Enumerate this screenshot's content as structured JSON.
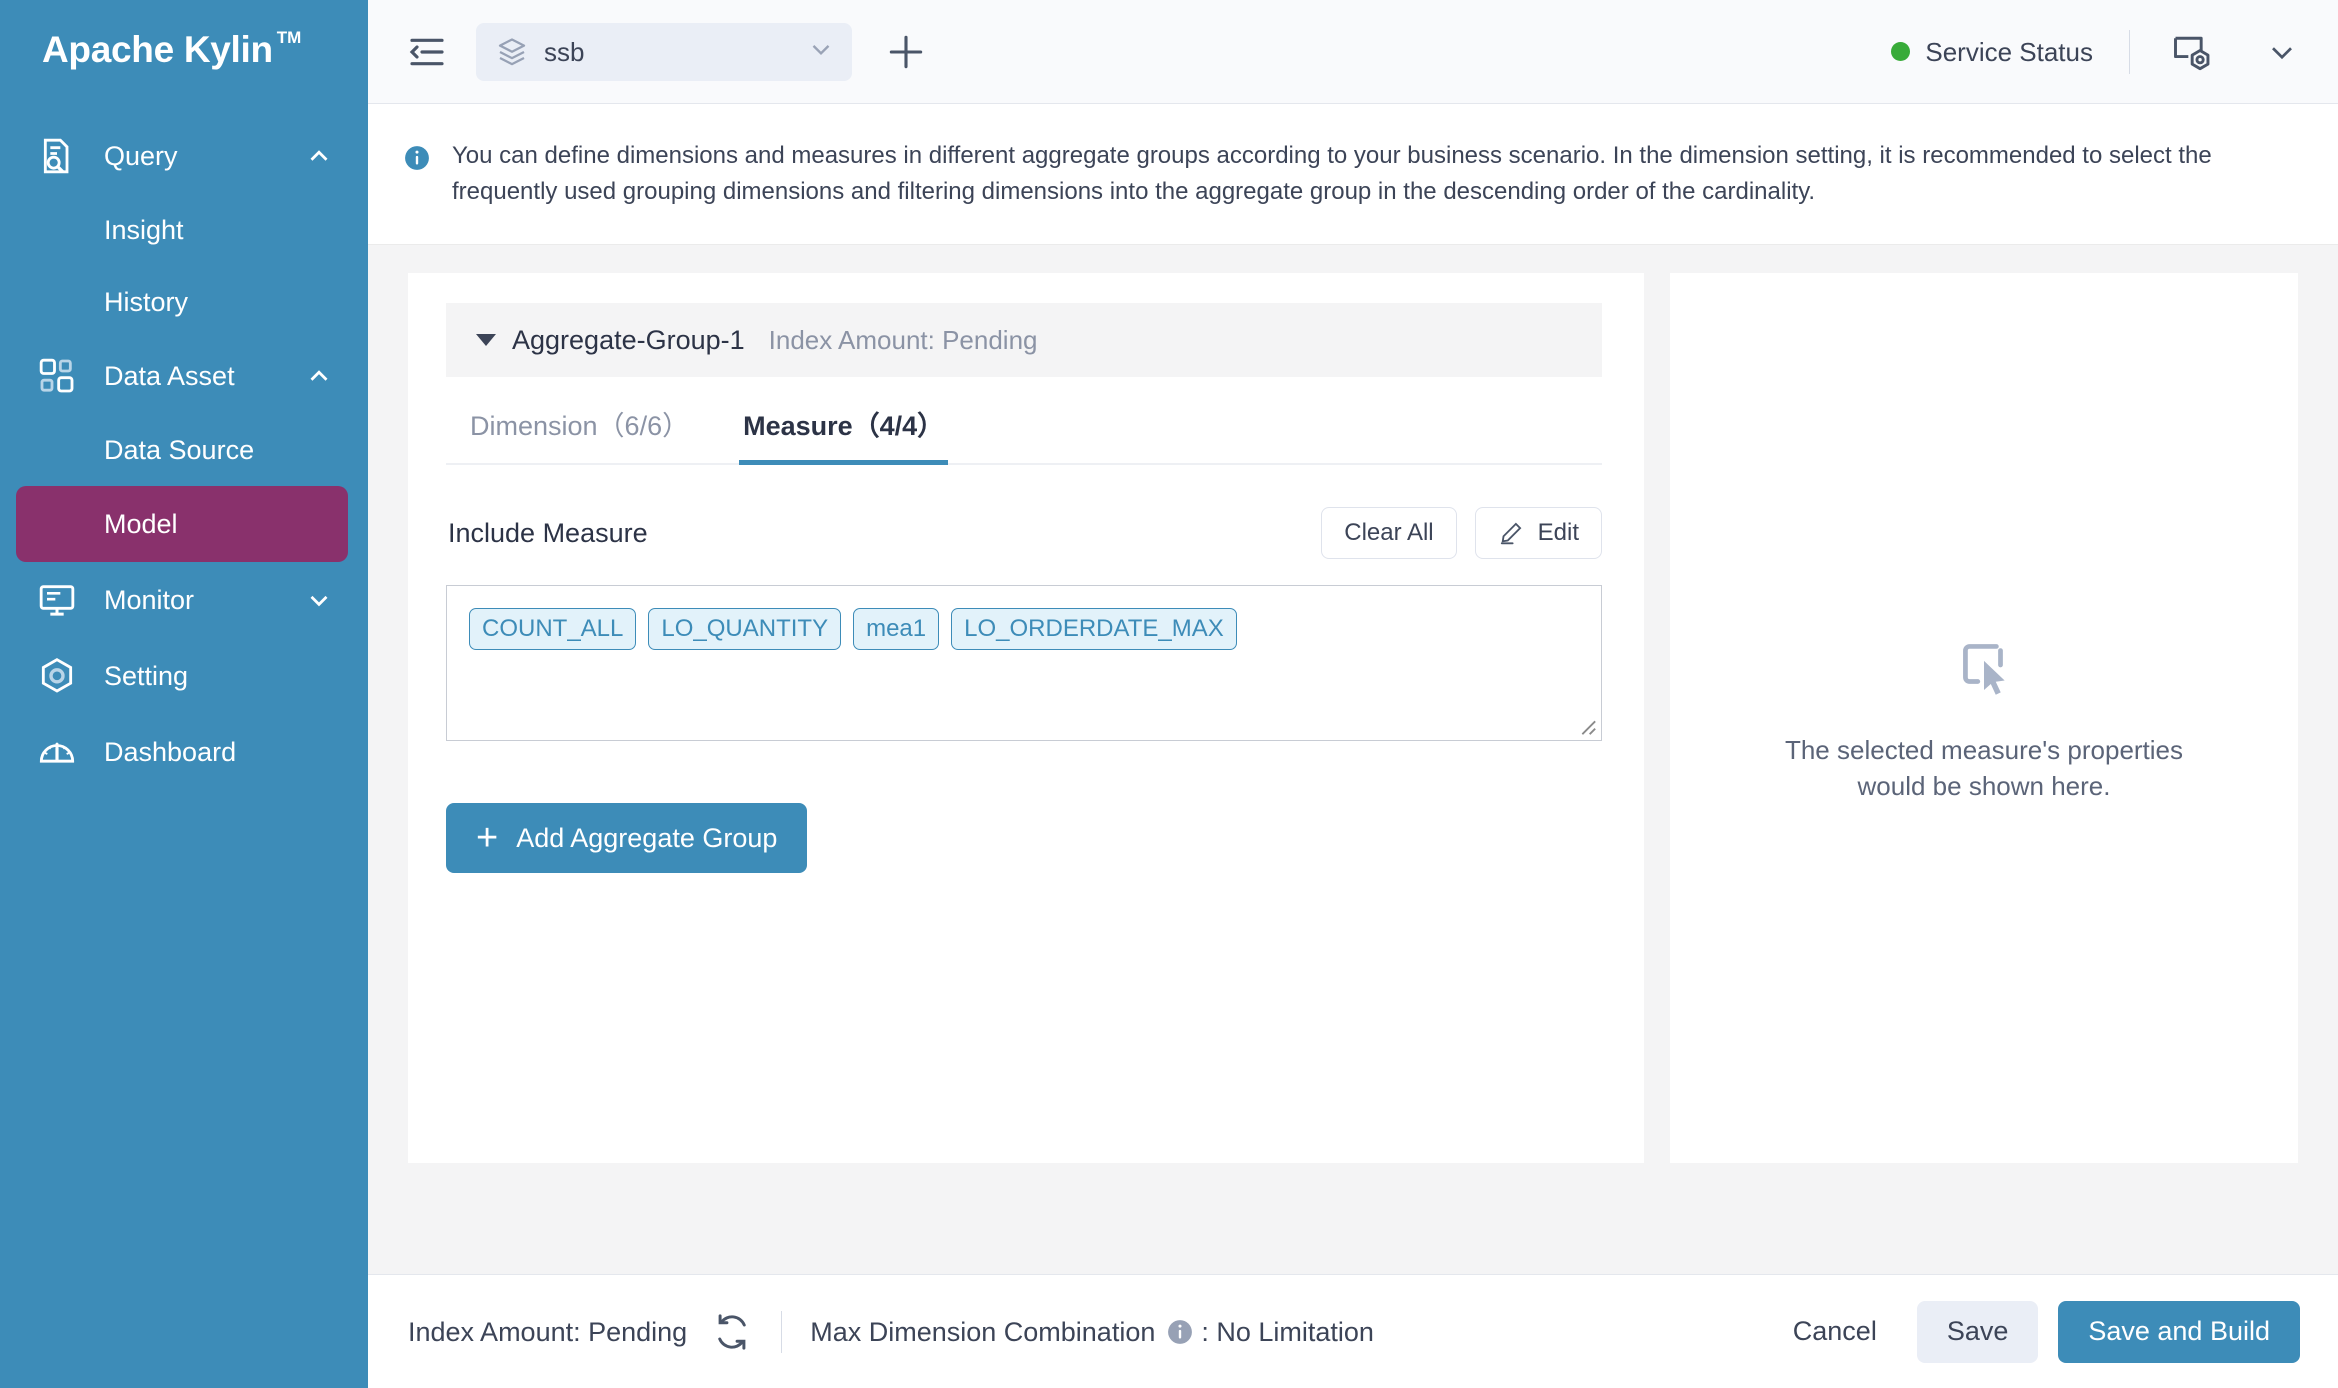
{
  "brand": {
    "name": "Apache Kylin",
    "tm": "TM"
  },
  "sidebar": {
    "items": [
      {
        "label": "Query",
        "icon": "query-icon",
        "chevron": "up"
      },
      {
        "label": "Insight",
        "sub": true
      },
      {
        "label": "History",
        "sub": true
      },
      {
        "label": "Data Asset",
        "icon": "data-asset-icon",
        "chevron": "up"
      },
      {
        "label": "Data Source",
        "sub": true
      },
      {
        "label": "Model",
        "sub": true,
        "active": true
      },
      {
        "label": "Monitor",
        "icon": "monitor-icon",
        "chevron": "down"
      },
      {
        "label": "Setting",
        "icon": "gear-icon"
      },
      {
        "label": "Dashboard",
        "icon": "dashboard-icon"
      }
    ]
  },
  "topbar": {
    "collapse_icon": "collapse-sidebar-icon",
    "project": {
      "name": "ssb",
      "icon": "layers-icon",
      "chevron": "chevron-down-icon"
    },
    "add_icon": "plus-icon",
    "service_status": {
      "label": "Service Status",
      "color": "#38ab39"
    },
    "admin_icon": "system-monitor-icon",
    "user_menu_icon": "chevron-down-icon"
  },
  "banner": {
    "icon": "info-icon",
    "text": "You can define dimensions and measures in different aggregate groups according to your business scenario. In the dimension setting, it is recommended to select the frequently used grouping dimensions and filtering dimensions into the aggregate group in the descending order of the cardinality."
  },
  "aggregate_group": {
    "title": "Aggregate-Group-1",
    "index_amount": "Index Amount: Pending",
    "tabs": [
      {
        "label": "Dimension（6/6）",
        "active": false
      },
      {
        "label": "Measure（4/4）",
        "active": true
      }
    ],
    "section_title": "Include Measure",
    "clear_all_label": "Clear All",
    "edit_label": "Edit",
    "measures": [
      "COUNT_ALL",
      "LO_QUANTITY",
      "mea1",
      "LO_ORDERDATE_MAX"
    ],
    "add_group_label": "Add Aggregate Group"
  },
  "right_panel": {
    "icon": "select-cursor-icon",
    "empty_line1": "The selected measure's properties",
    "empty_line2": "would be shown here."
  },
  "footer": {
    "index_amount": "Index Amount: Pending",
    "refresh_icon": "refresh-icon",
    "max_dim_label": "Max Dimension Combination",
    "max_dim_info_icon": "info-icon",
    "max_dim_value": ": No Limitation",
    "cancel_label": "Cancel",
    "save_label": "Save",
    "save_build_label": "Save and Build"
  },
  "colors": {
    "sidebar": "#3d8cb8",
    "active_nav": "#89316c",
    "primary": "#3d8cb8",
    "status_green": "#38ab39",
    "tag_bg": "#e2f2fa",
    "tag_border": "#3d8cb8"
  }
}
